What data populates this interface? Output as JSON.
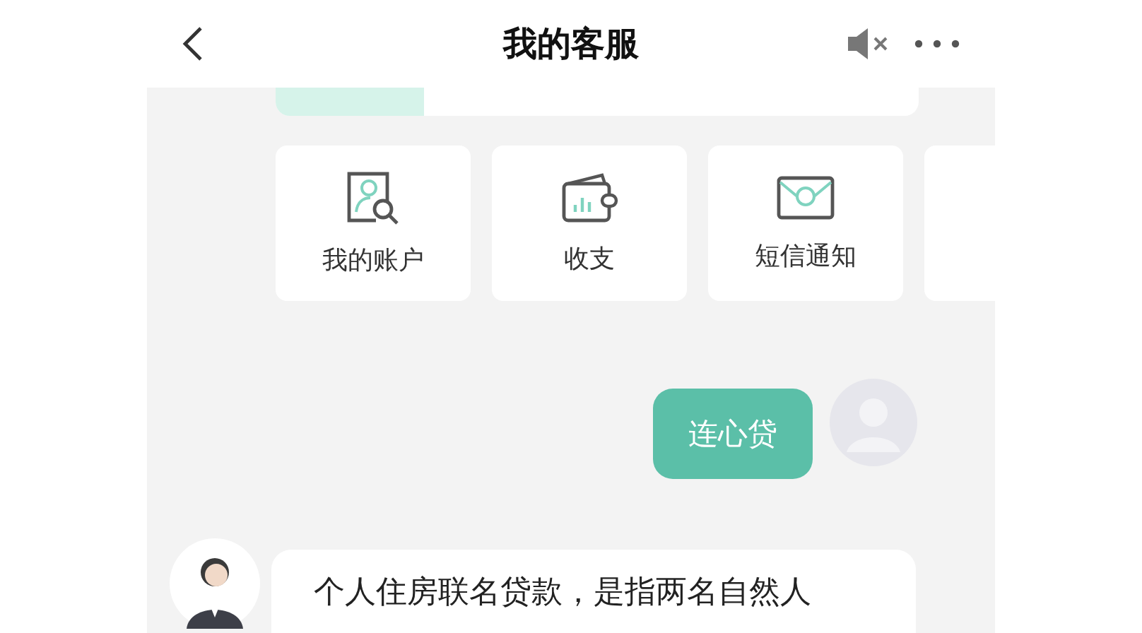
{
  "header": {
    "title": "我的客服"
  },
  "shortcuts": [
    {
      "kind": "account",
      "label": "我的账户"
    },
    {
      "kind": "wallet",
      "label": "收支"
    },
    {
      "kind": "sms",
      "label": "短信通知"
    },
    {
      "kind": "cut"
    }
  ],
  "messages": [
    {
      "kind": "user",
      "text": "连心贷"
    },
    {
      "kind": "agent",
      "text": "个人住房联名贷款，是指两名自然人"
    }
  ]
}
